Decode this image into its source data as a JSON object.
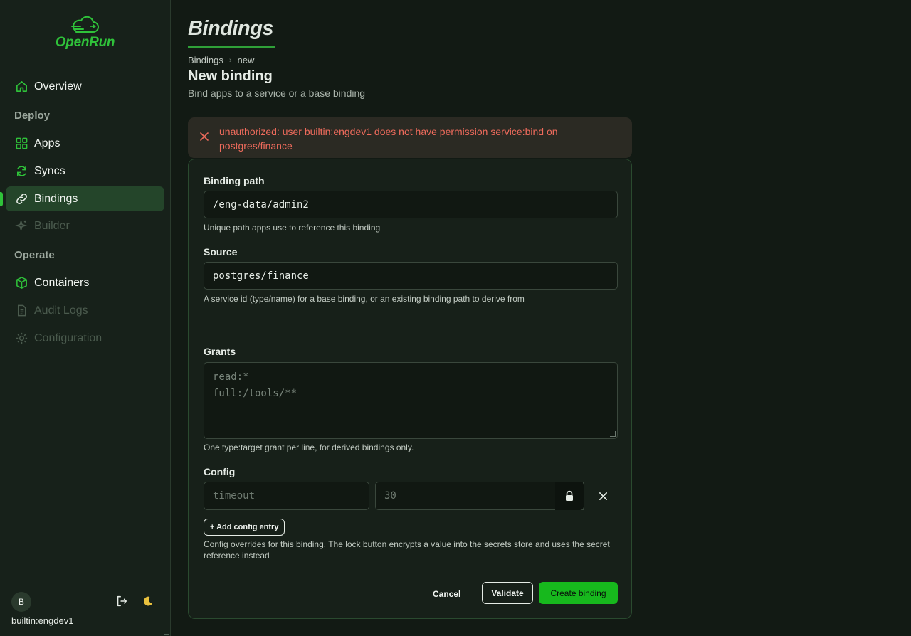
{
  "brand": {
    "name": "OpenRun",
    "accent": "#2fc23a"
  },
  "sidebar": {
    "items": [
      {
        "label": "Overview",
        "icon": "home-icon",
        "state": "normal"
      },
      {
        "label": "Apps",
        "icon": "grid-icon",
        "state": "normal"
      },
      {
        "label": "Syncs",
        "icon": "refresh-icon",
        "state": "normal"
      },
      {
        "label": "Bindings",
        "icon": "link-icon",
        "state": "active"
      },
      {
        "label": "Builder",
        "icon": "sparkle-icon",
        "state": "disabled"
      },
      {
        "label": "Containers",
        "icon": "cube-icon",
        "state": "normal"
      },
      {
        "label": "Audit Logs",
        "icon": "document-icon",
        "state": "disabled"
      },
      {
        "label": "Configuration",
        "icon": "gear-icon",
        "state": "disabled"
      }
    ],
    "sections": {
      "deploy": "Deploy",
      "operate": "Operate"
    },
    "footer": {
      "avatar_initial": "B",
      "username": "builtin:engdev1"
    }
  },
  "header": {
    "heading": "Bindings",
    "breadcrumb": [
      "Bindings",
      "new"
    ],
    "title": "New binding",
    "subtitle": "Bind apps to a service or a base binding"
  },
  "error": {
    "message": "unauthorized: user builtin:engdev1 does not have permission service:bind on postgres/finance",
    "color": "#ef6b5c"
  },
  "form": {
    "binding_path": {
      "label": "Binding path",
      "value": "/eng-data/admin2",
      "help": "Unique path apps use to reference this binding"
    },
    "source": {
      "label": "Source",
      "value": "postgres/finance",
      "help": "A service id (type/name) for a base binding, or an existing binding path to derive from"
    },
    "grants": {
      "label": "Grants",
      "placeholder_lines": [
        "read:*",
        "full:/tools/**"
      ],
      "help": "One type:target grant per line, for derived bindings only."
    },
    "config": {
      "label": "Config",
      "key_placeholder": "timeout",
      "value_placeholder": "30",
      "add_label": "+ Add config entry",
      "help": "Config overrides for this binding. The lock button encrypts a value into the secrets store and uses the secret reference instead"
    },
    "actions": {
      "cancel": "Cancel",
      "validate": "Validate",
      "create": "Create binding"
    }
  }
}
